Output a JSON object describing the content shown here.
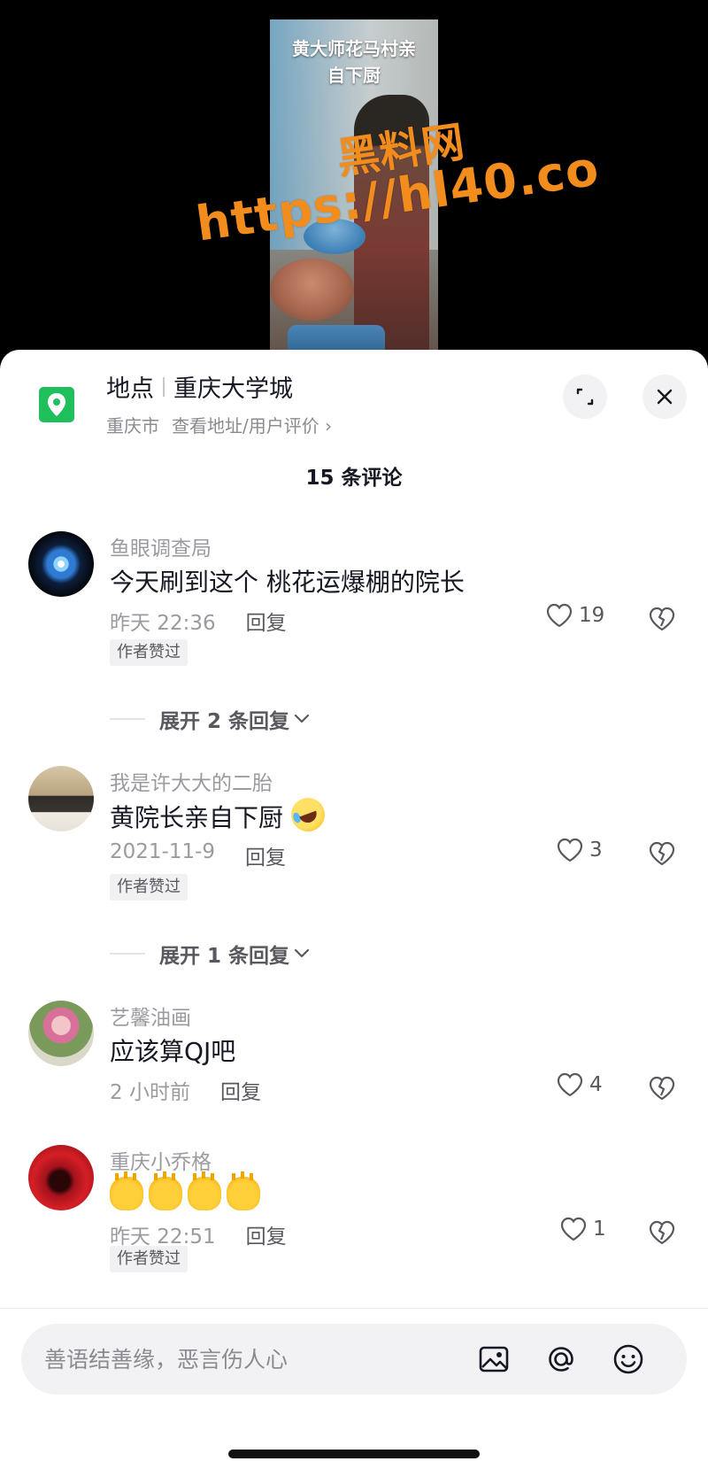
{
  "video": {
    "caption_line1": "黄大师花马村亲",
    "caption_line2": "自下厨",
    "watermark_cn": "黑料网",
    "watermark_url": "https://hl40.co"
  },
  "location": {
    "label": "地点",
    "name": "重庆大学城",
    "city": "重庆市",
    "link": "查看地址/用户评价 ›"
  },
  "comment_count": "15 条评论",
  "comments": [
    {
      "user": "鱼眼调查局",
      "text": "今天刷到这个 桃花运爆棚的院长",
      "time": "昨天 22:36",
      "reply": "回复",
      "likes": "19",
      "badge": "作者赞过",
      "expand": "展开 2 条回复"
    },
    {
      "user": "我是许大大的二胎",
      "text": "黄院长亲自下厨",
      "time": "2021-11-9",
      "reply": "回复",
      "likes": "3",
      "badge": "作者赞过",
      "expand": "展开 1 条回复"
    },
    {
      "user": "艺馨油画",
      "text": "应该算QJ吧",
      "time": "2 小时前",
      "reply": "回复",
      "likes": "4"
    },
    {
      "user": "重庆小乔格",
      "time": "昨天 22:51",
      "reply": "回复",
      "likes": "1",
      "badge": "作者赞过"
    }
  ],
  "input": {
    "placeholder": "善语结善缘，恶言伤人心"
  },
  "colors": {
    "accent_green": "#1fbf5b",
    "watermark_orange": "#f28c1c",
    "text_primary": "#161823",
    "text_secondary": "#9a9ba1"
  },
  "icons": [
    "location-pin-icon",
    "expand-icon",
    "close-icon",
    "heart-icon",
    "broken-heart-icon",
    "image-icon",
    "at-icon",
    "emoji-icon"
  ]
}
